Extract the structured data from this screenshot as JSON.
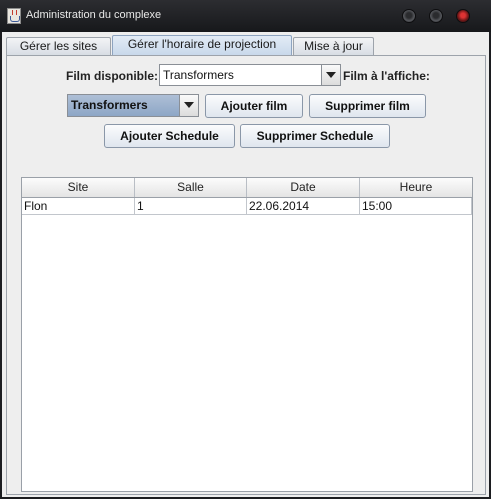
{
  "window": {
    "title": "Administration du complexe"
  },
  "tabs": [
    {
      "label": "Gérer les sites"
    },
    {
      "label": "Gérer l'horaire de projection"
    },
    {
      "label": "Mise à jour"
    }
  ],
  "form": {
    "film_disponible_label": "Film disponible:",
    "film_disponible_value": "Transformers",
    "film_affiche_label": "Film à l'affiche:",
    "film_affiche_value": "Transformers",
    "ajouter_film": "Ajouter film",
    "supprimer_film": "Supprimer film",
    "ajouter_schedule": "Ajouter Schedule",
    "supprimer_schedule": "Supprimer Schedule"
  },
  "table": {
    "columns": [
      "Site",
      "Salle",
      "Date",
      "Heure"
    ],
    "rows": [
      [
        "Flon",
        "1",
        "22.06.2014",
        "15:00"
      ]
    ]
  }
}
